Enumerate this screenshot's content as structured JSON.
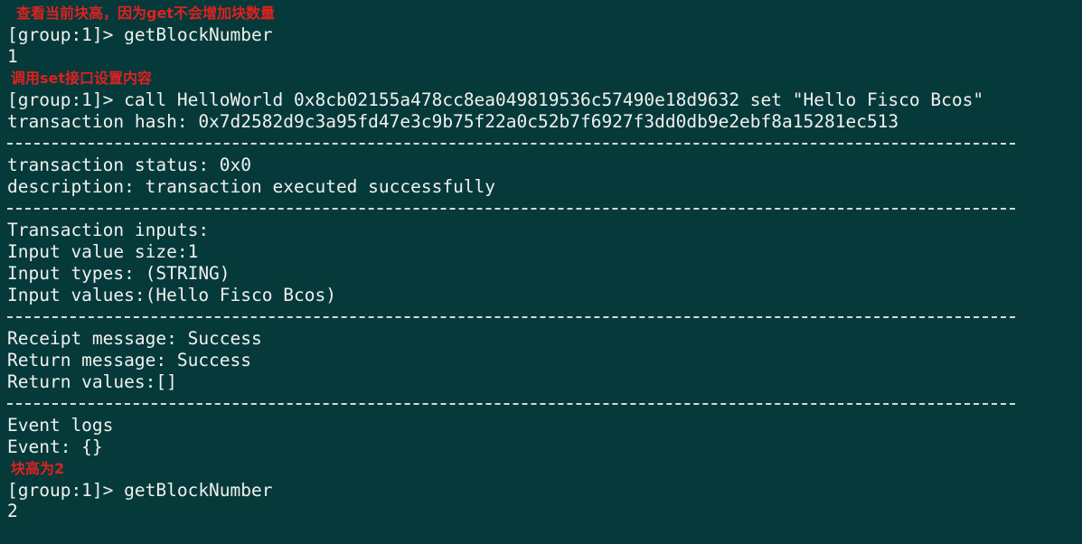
{
  "annotations": {
    "note1": "查看当前块高，因为get不会增加块数量",
    "note2": "调用set接口设置内容",
    "note3": "块高为2"
  },
  "console": {
    "cmd1": "[group:1]> getBlockNumber",
    "out1": "1",
    "cmd2": "[group:1]> call HelloWorld 0x8cb02155a478cc8ea049819536c57490e18d9632 set \"Hello Fisco Bcos\"",
    "tx_hash": "transaction hash: 0x7d2582d9c3a95fd47e3c9b75f22a0c52b7f6927f3dd0db9e2ebf8a15281ec513",
    "tx_status": "transaction status: 0x0",
    "description": "description: transaction executed successfully",
    "inputs_header": "Transaction inputs:",
    "input_size": "Input value size:1",
    "input_types": "Input types: (STRING)",
    "input_values": "Input values:(Hello Fisco Bcos)",
    "receipt_message": "Receipt message: Success",
    "return_message": "Return message: Success",
    "return_values": "Return values:[]",
    "event_logs": "Event logs",
    "event": "Event: {}",
    "cmd3": "[group:1]> getBlockNumber",
    "out3": "2"
  },
  "colors": {
    "background": "#063a3a",
    "text": "#f0f0f0",
    "annotation": "#e02020"
  }
}
